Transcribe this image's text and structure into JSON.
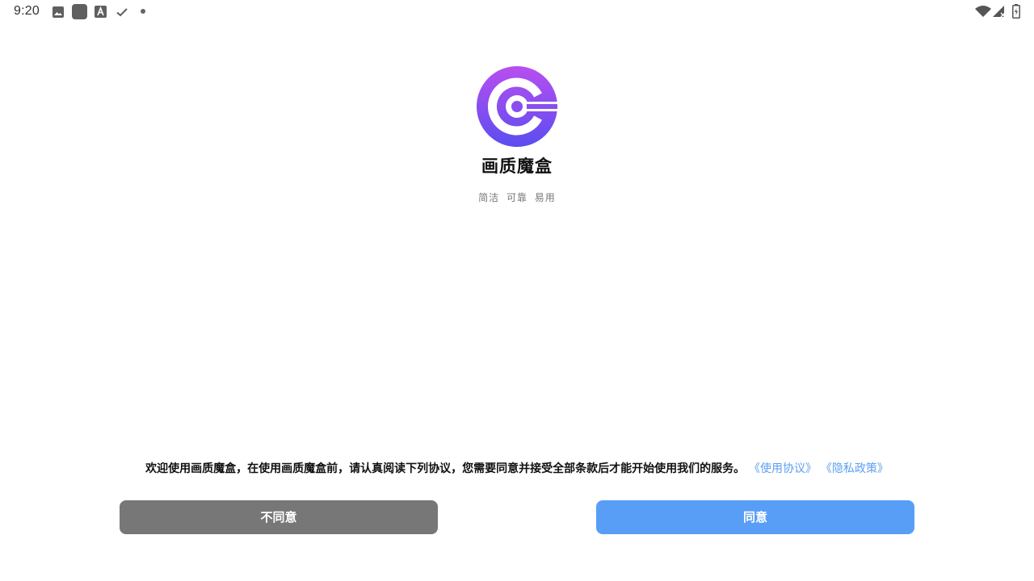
{
  "status_bar": {
    "time": "9:20",
    "icons": [
      "image-icon",
      "app-square-icon",
      "font-a-icon",
      "check-icon",
      "dot-icon",
      "wifi-icon",
      "signal-icon",
      "battery-icon"
    ]
  },
  "app": {
    "name": "画质魔盒",
    "tagline": "简洁 可靠 易用",
    "logo_colors": {
      "top": "#b84ef0",
      "bottom": "#5b4df0"
    }
  },
  "agreement": {
    "text": "欢迎使用画质魔盒，在使用画质魔盒前，请认真阅读下列协议，您需要同意并接受全部条款后才能开始使用我们的服务。",
    "terms_link": "《使用协议》",
    "privacy_link": "《隐私政策》"
  },
  "buttons": {
    "disagree": "不同意",
    "agree": "同意"
  },
  "colors": {
    "link": "#5b9ef1",
    "disagree_button": "#777777",
    "agree_button": "#589ef6"
  }
}
